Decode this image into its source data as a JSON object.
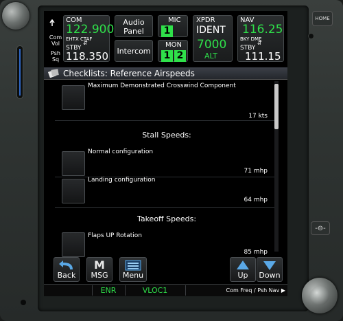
{
  "hardware": {
    "home_label": "HOME",
    "side_button_glyph": "-⊖-"
  },
  "top_bar": {
    "com_vol_label_1": "Com",
    "com_vol_label_2": "Vol",
    "psh_label_1": "Psh",
    "psh_label_2": "Sq",
    "com": {
      "label": "COM",
      "active_freq": "122.900",
      "active_ident": "EHTX CTAF",
      "stby_label": "STBY",
      "stby_freq": "118.350"
    },
    "audio_panel_label_1": "Audio",
    "audio_panel_label_2": "Panel",
    "intercom_label": "Intercom",
    "mic": {
      "label": "MIC",
      "value": "1"
    },
    "mon": {
      "label": "MON",
      "value_1": "1",
      "value_2": "2"
    },
    "xpdr": {
      "label": "XPDR",
      "mode": "IDENT",
      "code": "7000",
      "alt_label": "ALT"
    },
    "nav": {
      "label": "NAV",
      "active_freq": "116.25",
      "active_ident": "BKY DME",
      "stby_label": "STBY",
      "stby_freq": "111.15"
    }
  },
  "header": {
    "title": "Checklists: Reference Airspeeds"
  },
  "list": {
    "items": [
      {
        "name": "Maximum Demonstrated Crosswind Component",
        "value": "17 kts"
      },
      {
        "name": "Normal configuration",
        "value": "71 mhp"
      },
      {
        "name": "Landing configuration",
        "value": "64 mhp"
      },
      {
        "name": "Flaps UP Rotation",
        "value": "85 mhp"
      }
    ],
    "sections": [
      "Stall Speeds:",
      "Takeoff Speeds:"
    ]
  },
  "softkeys": {
    "back": "Back",
    "msg_glyph": "M",
    "msg": "MSG",
    "menu": "Menu",
    "up": "Up",
    "down": "Down"
  },
  "status_bar": {
    "enr": "ENR",
    "vloc": "VLOC1",
    "hint": "Com Freq / Psh Nav ▶"
  },
  "colors": {
    "active_green": "#2fe04a",
    "accent_blue": "#5aa8e6"
  }
}
